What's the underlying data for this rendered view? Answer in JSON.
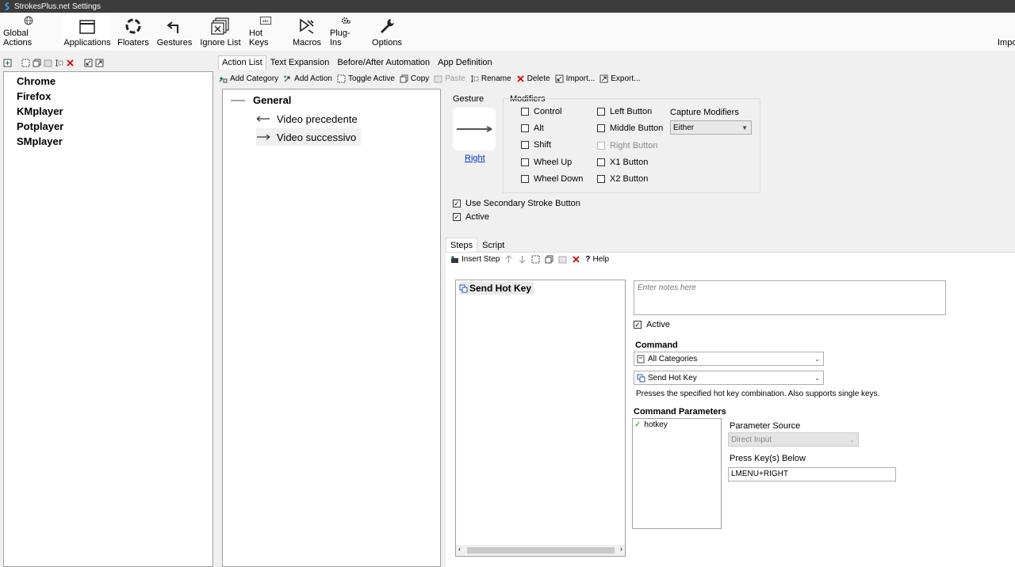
{
  "window": {
    "title": "StrokesPlus.net Settings"
  },
  "ribbon": {
    "items": [
      {
        "label": "Global Actions"
      },
      {
        "label": "Applications"
      },
      {
        "label": "Floaters"
      },
      {
        "label": "Gestures"
      },
      {
        "label": "Ignore List"
      },
      {
        "label": "Hot Keys"
      },
      {
        "label": "Macros"
      },
      {
        "label": "Plug-Ins"
      },
      {
        "label": "Options"
      }
    ],
    "truncated": "Impo"
  },
  "applications": [
    "Chrome",
    "Firefox",
    "KMplayer",
    "Potplayer",
    "SMplayer"
  ],
  "tabs": [
    "Action List",
    "Text Expansion",
    "Before/After Automation",
    "App Definition"
  ],
  "toolbar": {
    "add_category": "Add Category",
    "add_action": "Add Action",
    "toggle_active": "Toggle Active",
    "copy": "Copy",
    "paste": "Paste",
    "rename": "Rename",
    "delete": "Delete",
    "import": "Import...",
    "export": "Export..."
  },
  "action_tree": {
    "category": "General",
    "actions": [
      "Video precedente",
      "Video successivo"
    ]
  },
  "gesture": {
    "label": "Gesture",
    "name": "Right"
  },
  "modifiers": {
    "label": "Modifiers",
    "col1": [
      "Control",
      "Alt",
      "Shift",
      "Wheel Up",
      "Wheel Down"
    ],
    "col2": [
      "Left Button",
      "Middle Button",
      "Right Button",
      "X1 Button",
      "X2 Button"
    ],
    "capture_label": "Capture Modifiers",
    "capture_value": "Either"
  },
  "options": {
    "secondary": "Use Secondary Stroke Button",
    "active": "Active"
  },
  "subtabs": [
    "Steps",
    "Script"
  ],
  "stepbar": {
    "insert": "Insert Step",
    "help": "Help"
  },
  "step": {
    "name": "Send Hot Key"
  },
  "notes": {
    "placeholder": "Enter notes here"
  },
  "step_active": "Active",
  "command": {
    "label": "Command",
    "category": "All Categories",
    "name": "Send Hot Key",
    "description": "Presses the specified hot key combination. Also supports single keys."
  },
  "params": {
    "label": "Command Parameters",
    "item": "hotkey",
    "source_label": "Parameter Source",
    "source_value": "Direct Input",
    "press_label": "Press Key(s) Below",
    "keys": "LMENU+RIGHT"
  }
}
